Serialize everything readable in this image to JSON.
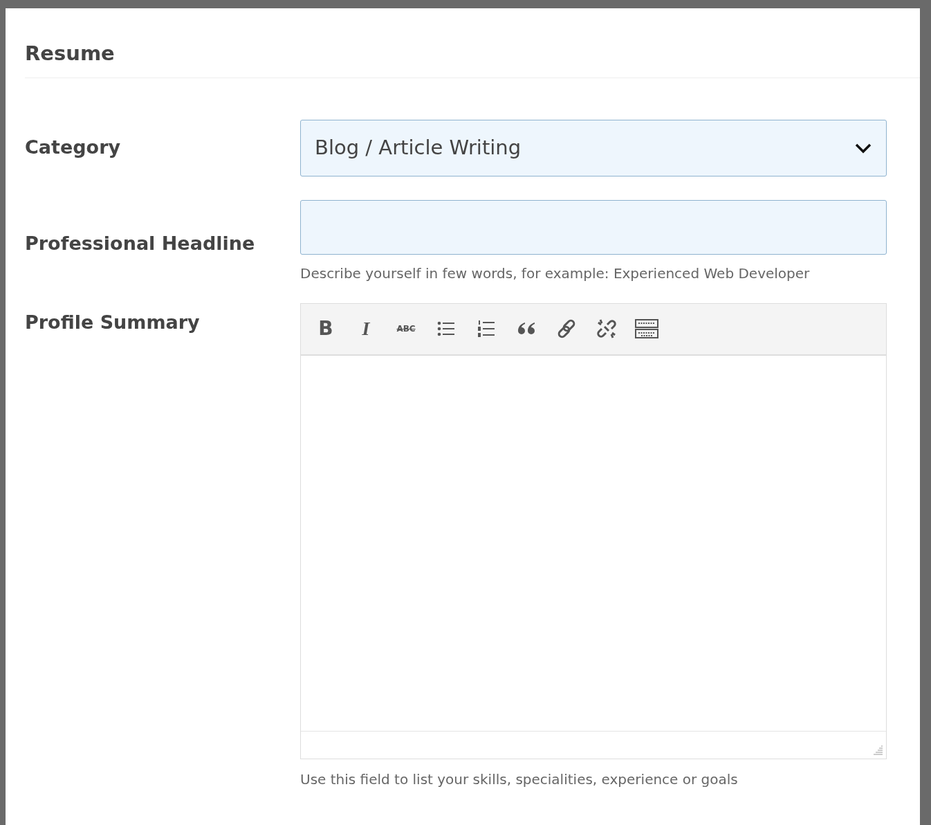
{
  "section": {
    "title": "Resume"
  },
  "fields": [
    {
      "kind": "select",
      "label": "Category",
      "value": "Blog / Article Writing"
    },
    {
      "kind": "input",
      "label": "Professional Headline",
      "help": "Describe yourself in few words, for example: Experienced Web Developer"
    },
    {
      "kind": "editor",
      "label": "Profile Summary",
      "help": "Use this field to list your skills, specialities, experience or goals",
      "toolbar": [
        {
          "kind": "bold",
          "label": "B"
        },
        {
          "kind": "italic",
          "label": "I"
        },
        {
          "kind": "strike",
          "label": "ABC"
        },
        {
          "kind": "bullets"
        },
        {
          "kind": "numbers"
        },
        {
          "kind": "quote"
        },
        {
          "kind": "link"
        },
        {
          "kind": "unlink"
        },
        {
          "kind": "keyboard"
        }
      ]
    }
  ]
}
